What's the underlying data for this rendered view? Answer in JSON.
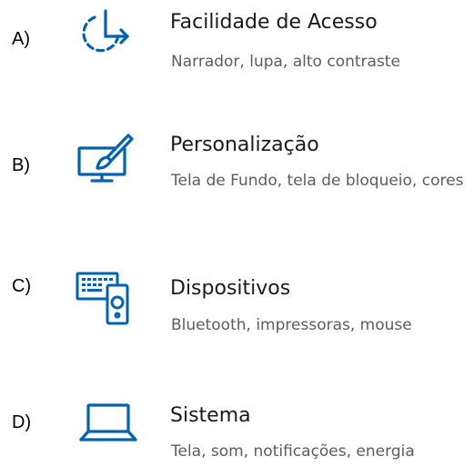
{
  "colors": {
    "icon_accent": "#0063b1",
    "title_text": "#1a1a1a",
    "description_text": "#5c5c5c"
  },
  "options": [
    {
      "letter": "A)",
      "icon": "ease-of-access-icon",
      "title": "Facilidade de Acesso",
      "description": "Narrador, lupa, alto contraste"
    },
    {
      "letter": "B)",
      "icon": "personalization-icon",
      "title": "Personalização",
      "description": "Tela de Fundo, tela de bloqueio, cores"
    },
    {
      "letter": "C)",
      "icon": "devices-icon",
      "title": "Dispositivos",
      "description": "Bluetooth, impressoras, mouse"
    },
    {
      "letter": "D)",
      "icon": "laptop-icon",
      "title": "Sistema",
      "description": "Tela, som, notificações, energia"
    }
  ]
}
